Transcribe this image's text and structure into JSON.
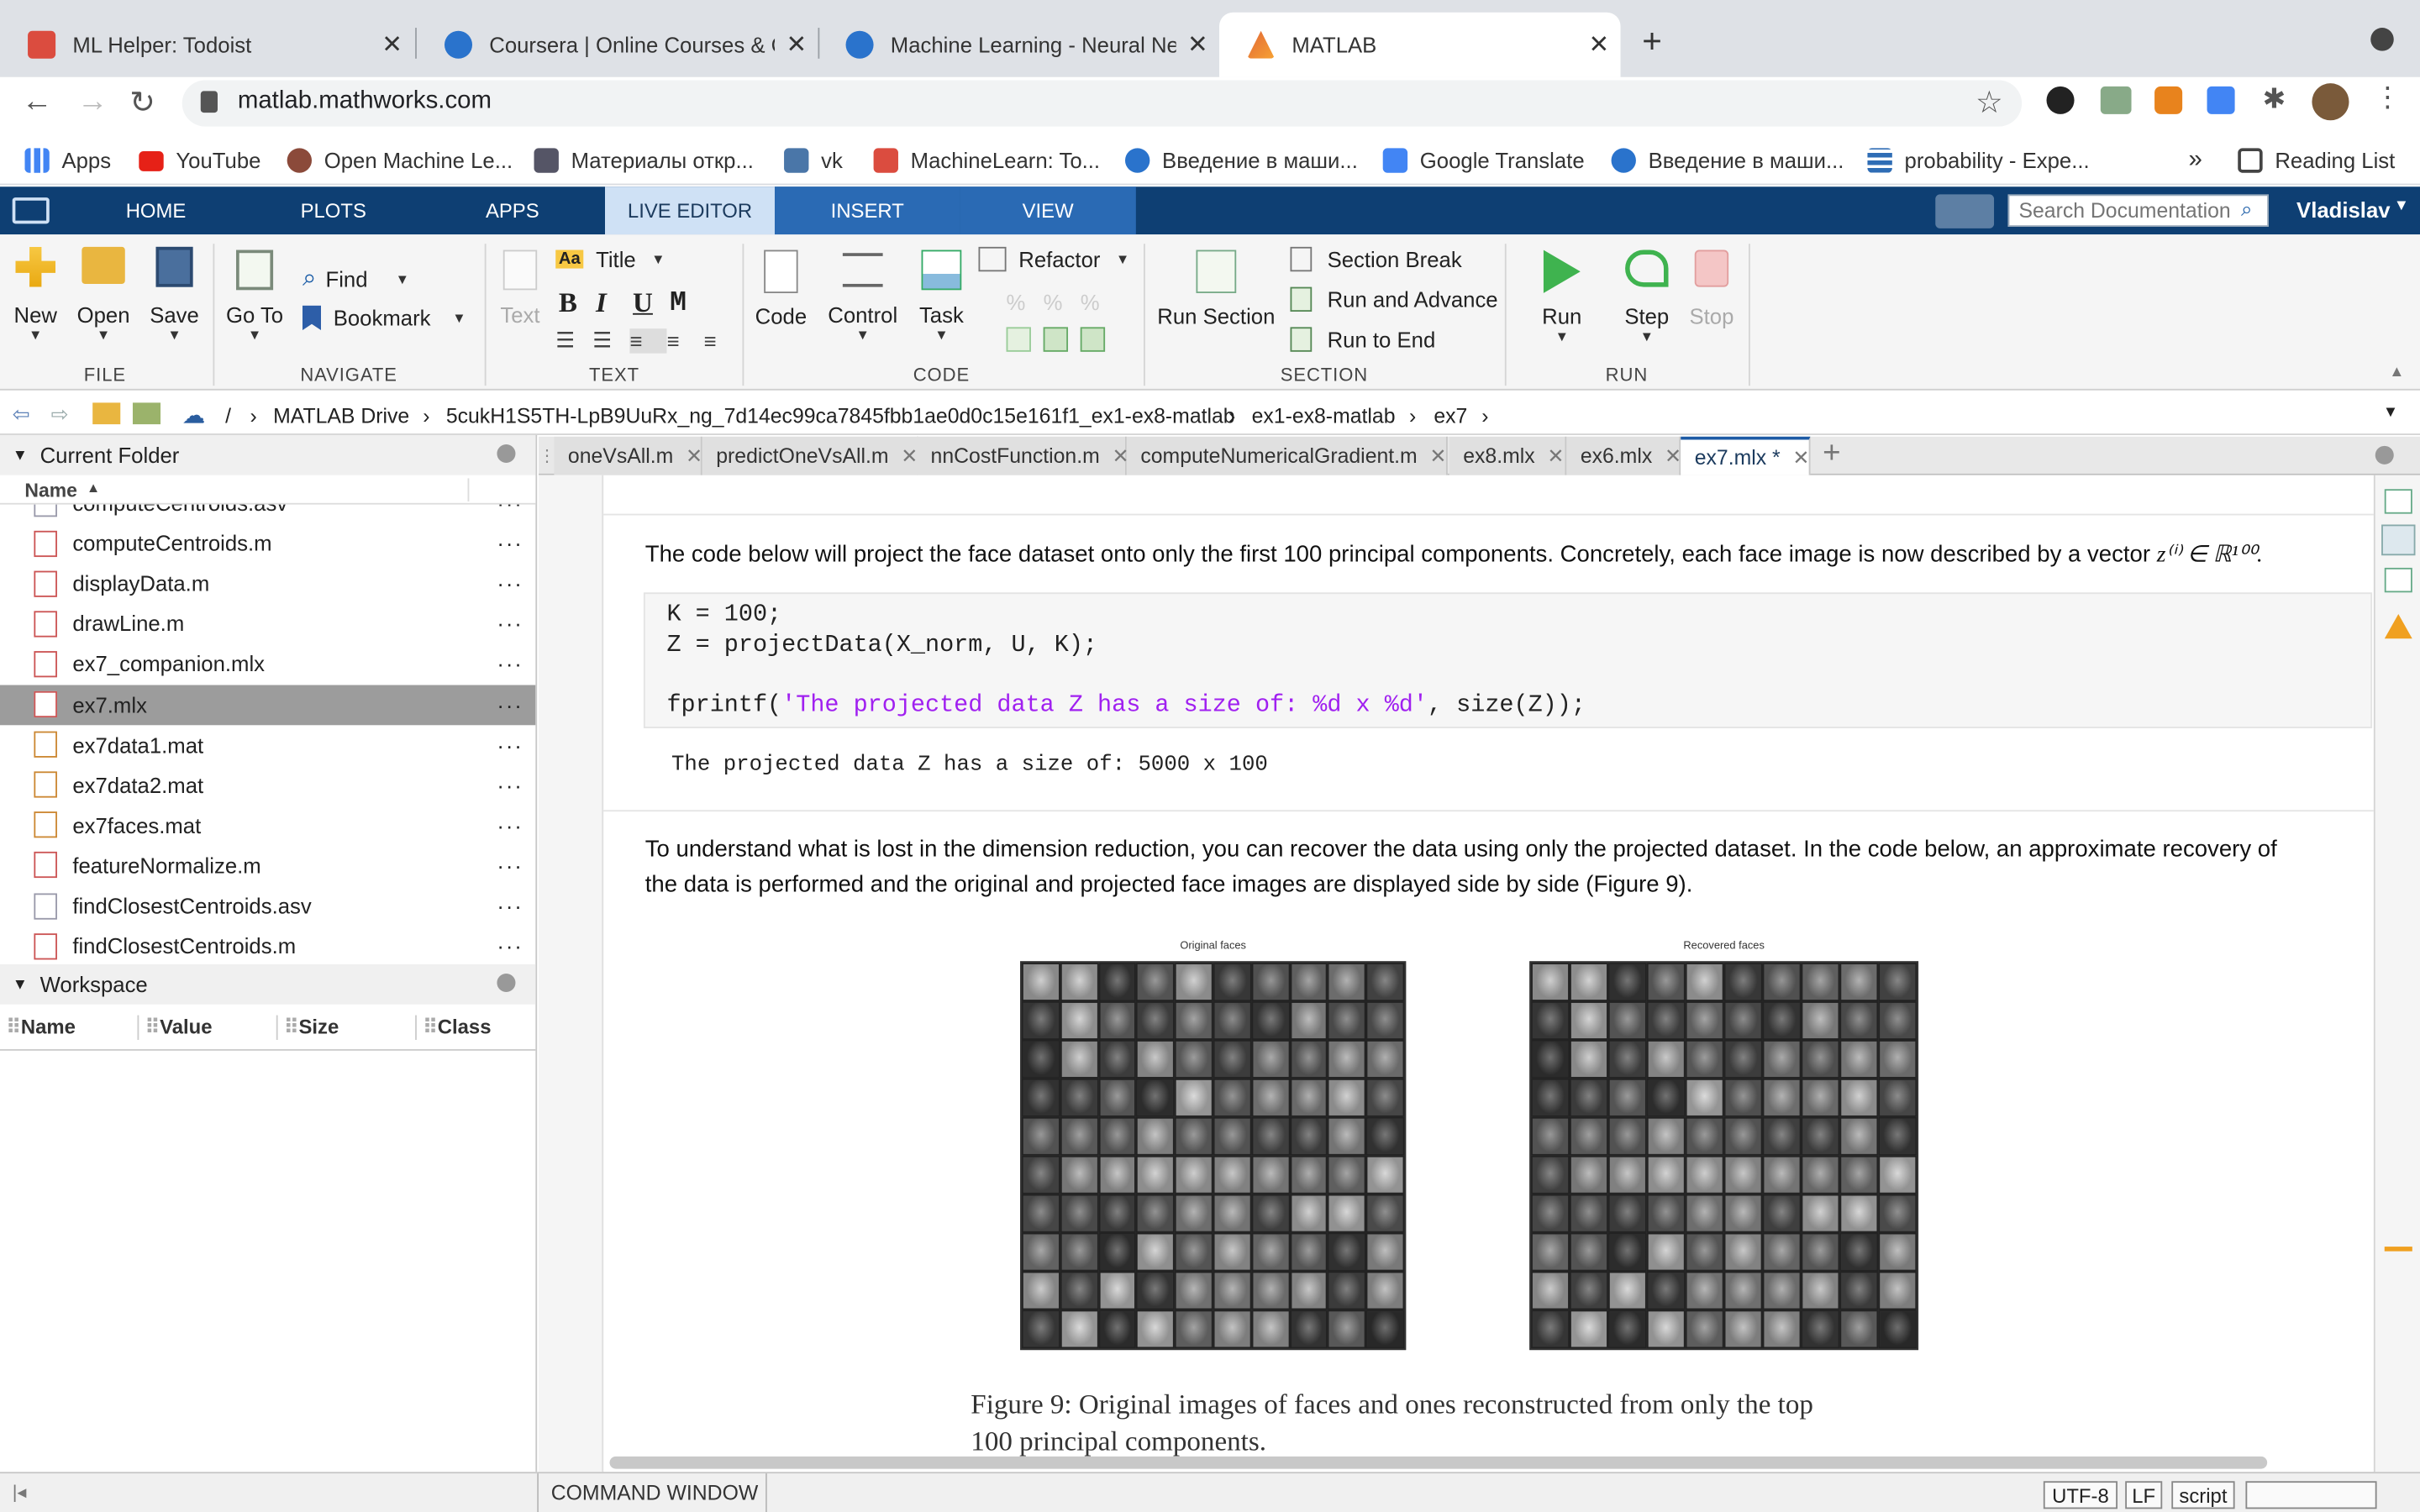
{
  "browser": {
    "tabs": [
      {
        "title": "ML Helper: Todoist",
        "color": "#db4c3f"
      },
      {
        "title": "Coursera | Online Courses & Cre",
        "color": "#2a73cc"
      },
      {
        "title": "Machine Learning - Neural Netw",
        "color": "#2a73cc"
      },
      {
        "title": "MATLAB",
        "color": "#e16737"
      }
    ],
    "url": "matlab.mathworks.com",
    "bookmarks": [
      {
        "label": "Apps"
      },
      {
        "label": "YouTube"
      },
      {
        "label": "Open Machine Le..."
      },
      {
        "label": "Материалы откр..."
      },
      {
        "label": "vk"
      },
      {
        "label": "MachineLearn: To..."
      },
      {
        "label": "Введение в маши..."
      },
      {
        "label": "Google Translate"
      },
      {
        "label": "Введение в маши..."
      },
      {
        "label": "probability - Expe..."
      }
    ],
    "overflow": "»",
    "reading_list": "Reading List"
  },
  "matlab": {
    "tabs": [
      "HOME",
      "PLOTS",
      "APPS",
      "LIVE EDITOR",
      "INSERT",
      "VIEW"
    ],
    "active_tab": "LIVE EDITOR",
    "search_placeholder": "Search Documentation",
    "user": "Vladislav",
    "file_group": {
      "label": "FILE",
      "new": "New",
      "open": "Open",
      "save": "Save"
    },
    "navigate_group": {
      "label": "NAVIGATE",
      "goto": "Go To",
      "find": "Find",
      "bookmark": "Bookmark"
    },
    "text_group": {
      "label": "TEXT",
      "text": "Text",
      "title": "Title",
      "bold": "B",
      "italic": "I",
      "underline": "U",
      "mono": "M"
    },
    "code_group": {
      "label": "CODE",
      "code": "Code",
      "control": "Control",
      "task": "Task",
      "refactor": "Refactor"
    },
    "section_group": {
      "label": "SECTION",
      "run_section": "Run Section",
      "section_break": "Section Break",
      "run_advance": "Run and Advance",
      "run_end": "Run to End"
    },
    "run_group": {
      "label": "RUN",
      "run": "Run",
      "step": "Step",
      "stop": "Stop"
    }
  },
  "path": [
    "/",
    "MATLAB Drive",
    "5cukH1S5TH-LpB9UuRx_ng_7d14ec99ca7845fbb1ae0d0c15e161f1_ex1-ex8-matlab",
    "ex1-ex8-matlab",
    "ex7"
  ],
  "current_folder": {
    "title": "Current Folder",
    "name_header": "Name",
    "files": [
      {
        "name": "computeCentroids.asv",
        "type": "asv"
      },
      {
        "name": "computeCentroids.m",
        "type": "m"
      },
      {
        "name": "displayData.m",
        "type": "m"
      },
      {
        "name": "drawLine.m",
        "type": "m"
      },
      {
        "name": "ex7_companion.mlx",
        "type": "mlx"
      },
      {
        "name": "ex7.mlx",
        "type": "mlx",
        "selected": true
      },
      {
        "name": "ex7data1.mat",
        "type": "mat"
      },
      {
        "name": "ex7data2.mat",
        "type": "mat"
      },
      {
        "name": "ex7faces.mat",
        "type": "mat"
      },
      {
        "name": "featureNormalize.m",
        "type": "m"
      },
      {
        "name": "findClosestCentroids.asv",
        "type": "asv"
      },
      {
        "name": "findClosestCentroids.m",
        "type": "m"
      }
    ],
    "more": "···"
  },
  "workspace": {
    "title": "Workspace",
    "columns": [
      "Name",
      "Value",
      "Size",
      "Class"
    ]
  },
  "editor_tabs": [
    "oneVsAll.m",
    "predictOneVsAll.m",
    "nnCostFunction.m",
    "computeNumericalGradient.m",
    "ex8.mlx",
    "ex6.mlx",
    "ex7.mlx *"
  ],
  "active_editor_tab": "ex7.mlx *",
  "editor": {
    "para1": "The code below will project the face dataset onto only the first 100 principal components. Concretely, each face image is now described by a vector",
    "para1_math": "z⁽ⁱ⁾ ∈ ℝ¹⁰⁰.",
    "code_lines": [
      "K = 100;",
      "Z = projectData(X_norm, U, K);",
      "",
      "fprintf('The projected data Z has a size of: %d x %d', size(Z));"
    ],
    "code_fprintf": "fprintf(",
    "code_string": "'The projected data Z has a size of: %d x %d'",
    "code_tail": ", size(Z));",
    "output": "The projected data Z has a size of: 5000 x 100",
    "para2": "To understand what is lost in the dimension reduction, you can recover the data using only the projected dataset. In the code below, an approximate recovery of the data is performed and the original and projected face images are displayed side by side (Figure 9).",
    "fig_left_title": "Original faces",
    "fig_right_title": "Recovered faces",
    "caption_line1": "Figure 9: Original images of faces and ones reconstructed from only the top",
    "caption_line2": "100 principal components."
  },
  "status": {
    "command_window": "COMMAND WINDOW",
    "encoding": "UTF-8",
    "eol": "LF",
    "mode": "script"
  }
}
